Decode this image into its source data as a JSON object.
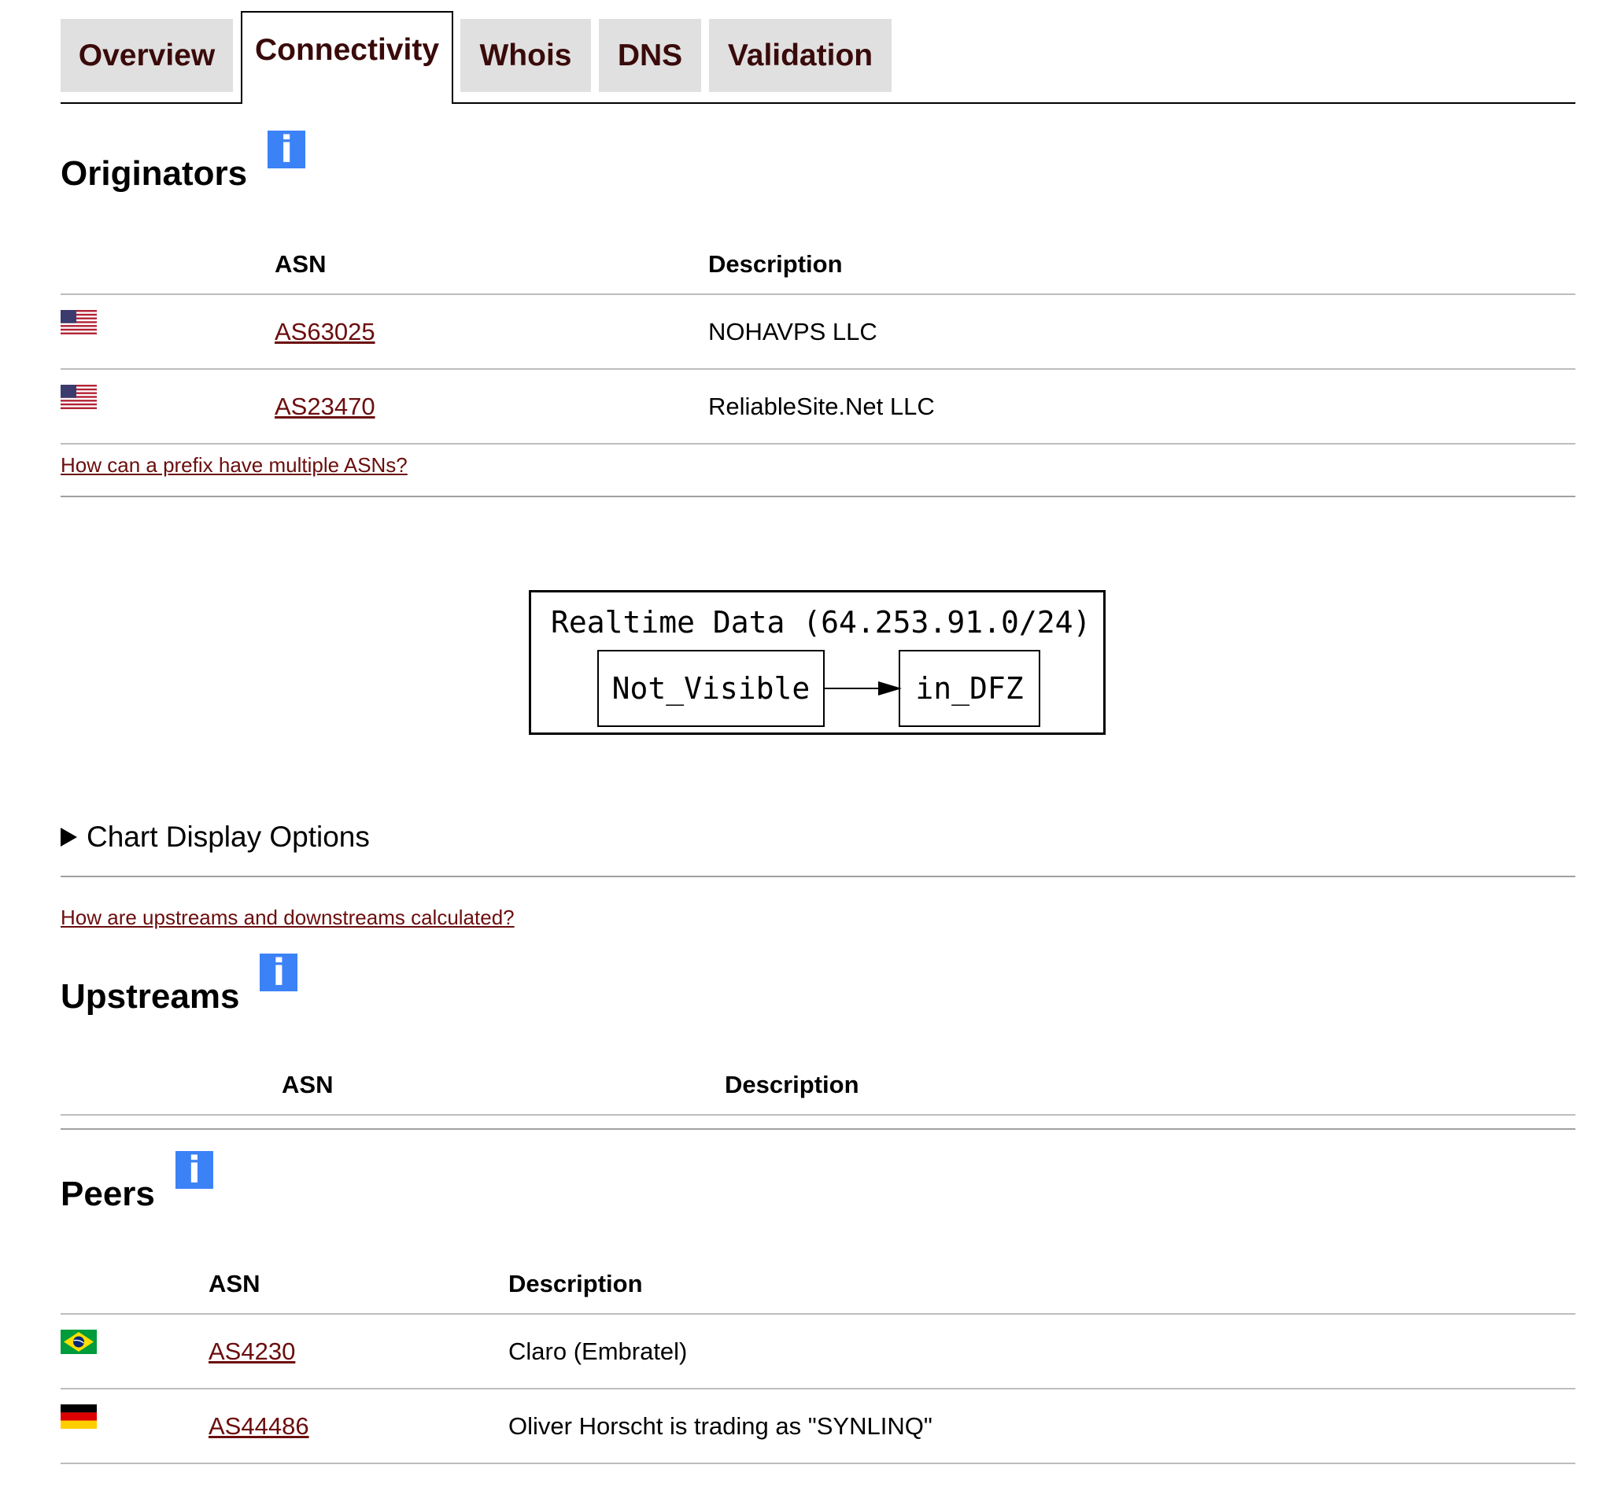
{
  "tabs": [
    {
      "label": "Overview",
      "active": false
    },
    {
      "label": "Connectivity",
      "active": true
    },
    {
      "label": "Whois",
      "active": false
    },
    {
      "label": "DNS",
      "active": false
    },
    {
      "label": "Validation",
      "active": false
    }
  ],
  "originators": {
    "title": "Originators",
    "info_icon": "i",
    "col_asn": "ASN",
    "col_description": "Description",
    "rows": [
      {
        "flag": "us-flag-icon",
        "asn": "AS63025",
        "description": "NOHAVPS LLC"
      },
      {
        "flag": "us-flag-icon",
        "asn": "AS23470",
        "description": "ReliableSite.Net LLC"
      }
    ],
    "help_link": "How can a prefix have multiple ASNs?"
  },
  "realtime": {
    "title": "Realtime Data (64.253.91.0/24)",
    "from_node": "Not_Visible",
    "to_node": "in_DFZ"
  },
  "chart_options": {
    "label": "Chart Display Options"
  },
  "upstreams": {
    "help_link": "How are upstreams and downstreams calculated?",
    "title": "Upstreams",
    "info_icon": "i",
    "col_asn": "ASN",
    "col_description": "Description"
  },
  "peers": {
    "title": "Peers",
    "info_icon": "i",
    "col_asn": "ASN",
    "col_description": "Description",
    "rows": [
      {
        "flag": "br-flag-icon",
        "asn": "AS4230",
        "description": "Claro (Embratel)"
      },
      {
        "flag": "de-flag-icon",
        "asn": "AS44486",
        "description": "Oliver Horscht is trading as \"SYNLINQ\""
      }
    ]
  },
  "colors": {
    "link": "#6b0d0d",
    "info": "#3b82f6",
    "tab_bg": "#e0e0e0"
  }
}
